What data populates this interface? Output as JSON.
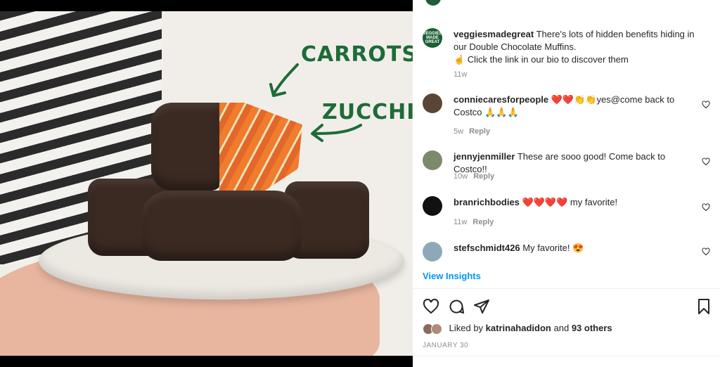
{
  "image": {
    "label_carrots": "CARROTS",
    "label_zucchini": "ZUCCHINI",
    "brand_color": "#1f6b38"
  },
  "caption": {
    "username": "veggiesmadegreat",
    "avatar_text": "VEGGIES MADE GREAT",
    "text_line1": "There's lots of hidden benefits hiding in our Double Chocolate Muffins.",
    "text_line2": "☝️ Click the link in our bio to discover them",
    "time": "11w"
  },
  "comments": [
    {
      "username": "conniecaresforpeople",
      "text": "❤️❤️👏👏yes@come back to Costco 🙏🙏🙏",
      "time": "5w",
      "reply": "Reply",
      "avatar_color": "#5a4636"
    },
    {
      "username": "jennyjenmiller",
      "text": "These are sooo good! Come back to Costco!!",
      "time": "10w",
      "reply": "Reply",
      "avatar_color": "#7a8a6a"
    },
    {
      "username": "branrichbodies",
      "text": "❤️❤️❤️❤️ my favorite!",
      "time": "11w",
      "reply": "Reply",
      "avatar_color": "#111111"
    },
    {
      "username": "stefschmidt426",
      "text": "My favorite! 😍",
      "time": "",
      "reply": "",
      "avatar_color": "#8fa8b8"
    }
  ],
  "insights_label": "View Insights",
  "likes": {
    "prefix": "Liked by",
    "user": "katrinahadidon",
    "and": "and",
    "others": "93 others"
  },
  "date": "JANUARY 30",
  "icons": [
    "heart-icon",
    "comment-icon",
    "share-icon",
    "bookmark-icon"
  ]
}
